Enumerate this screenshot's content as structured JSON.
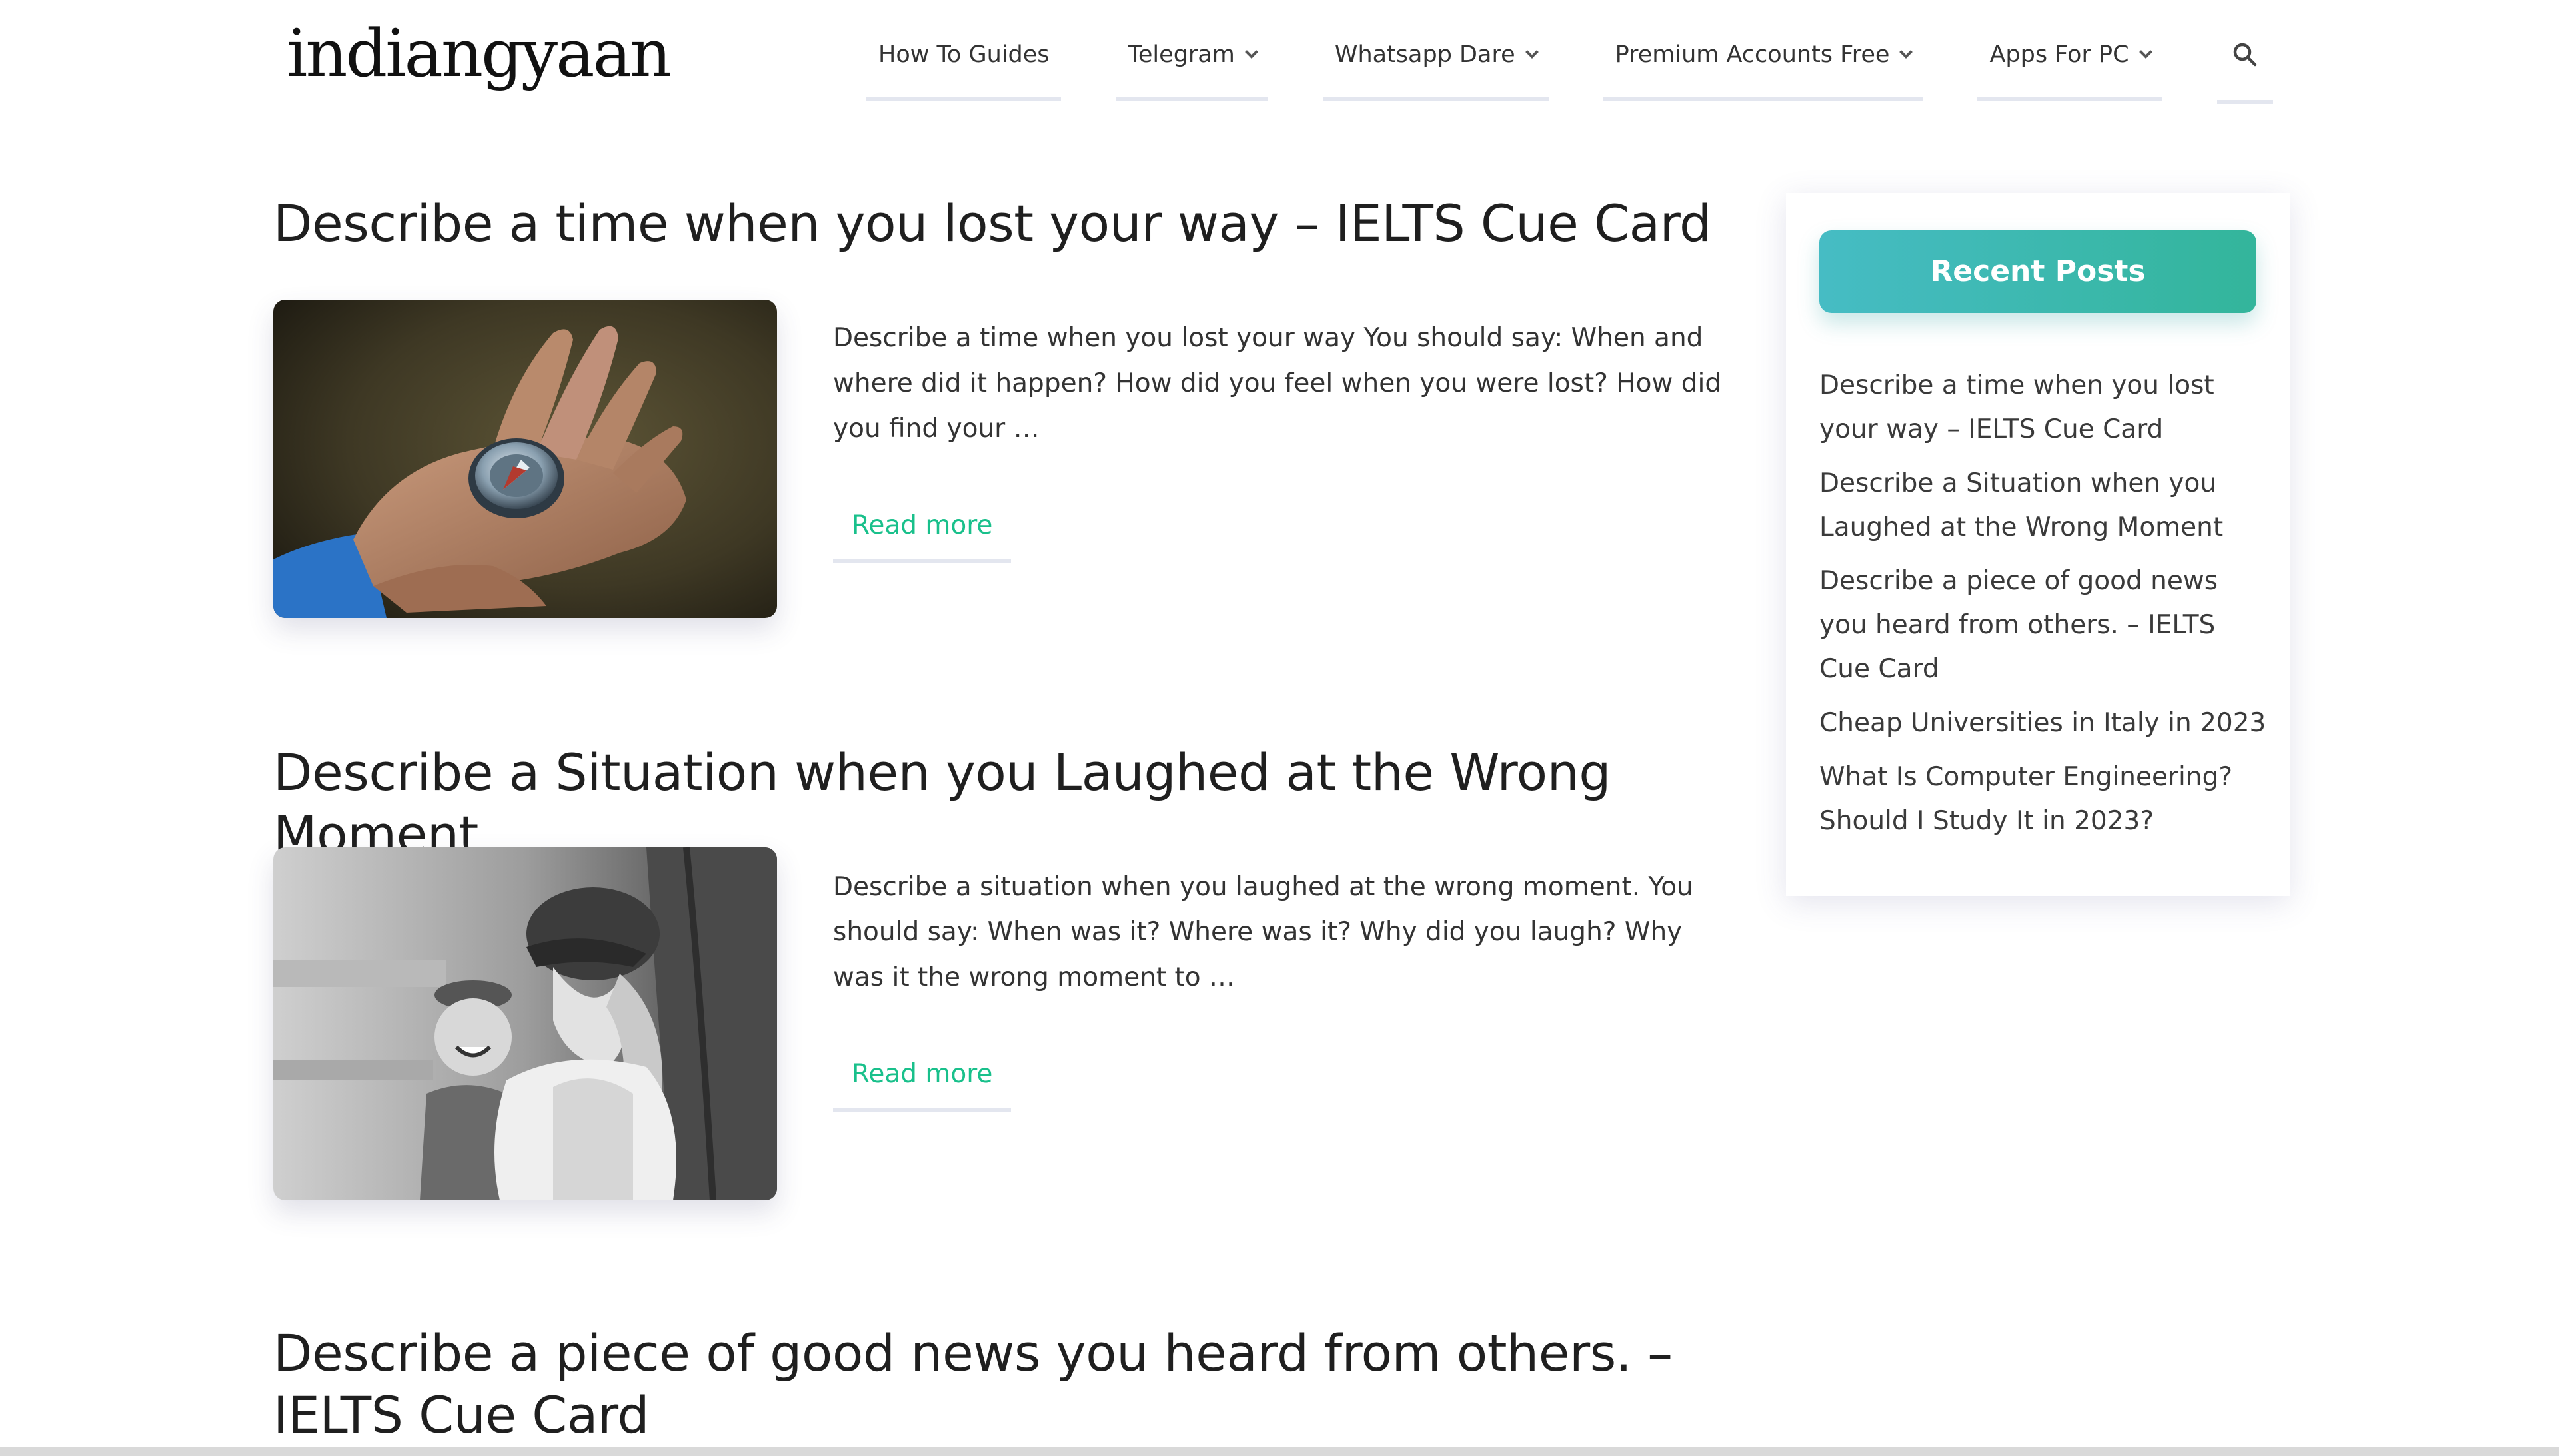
{
  "header": {
    "logo_text": "indiangyaan",
    "nav": [
      {
        "label": "How To Guides"
      },
      {
        "label": "Telegram"
      },
      {
        "label": "Whatsapp Dare"
      },
      {
        "label": "Premium Accounts Free"
      },
      {
        "label": "Apps For PC"
      }
    ],
    "search_icon": "search-icon"
  },
  "posts": [
    {
      "title": "Describe a time when you lost your way – IELTS Cue Card",
      "excerpt": "Describe a time when you lost your way You should say: When and where did it happen? How did you feel when you were lost? How did you find your …",
      "read_more": "Read more",
      "image": "hand-holding-compass-photo"
    },
    {
      "title": "Describe a Situation when you Laughed at the Wrong Moment",
      "excerpt": "Describe a situation when you laughed at the wrong moment. You should say: When was it? Where was it? Why did you laugh? Why was it the wrong moment to …",
      "read_more": "Read more",
      "image": "two-girls-laughing-photo"
    },
    {
      "title": "Describe a piece of good news you heard from others. – IELTS Cue Card"
    }
  ],
  "sidebar": {
    "widget_title": "Recent Posts",
    "recent_posts": [
      "Describe a time when you lost your way – IELTS Cue Card",
      "Describe a Situation when you Laughed at the Wrong Moment",
      "Describe a piece of good news you heard from others. – IELTS Cue Card",
      "Cheap Universities in Italy in 2023",
      "What Is Computer Engineering? Should I Study It in 2023?"
    ]
  },
  "colors": {
    "accent_green": "#19c08b",
    "widget_gradient_start": "#46bcc4",
    "widget_gradient_end": "#33b59b"
  }
}
